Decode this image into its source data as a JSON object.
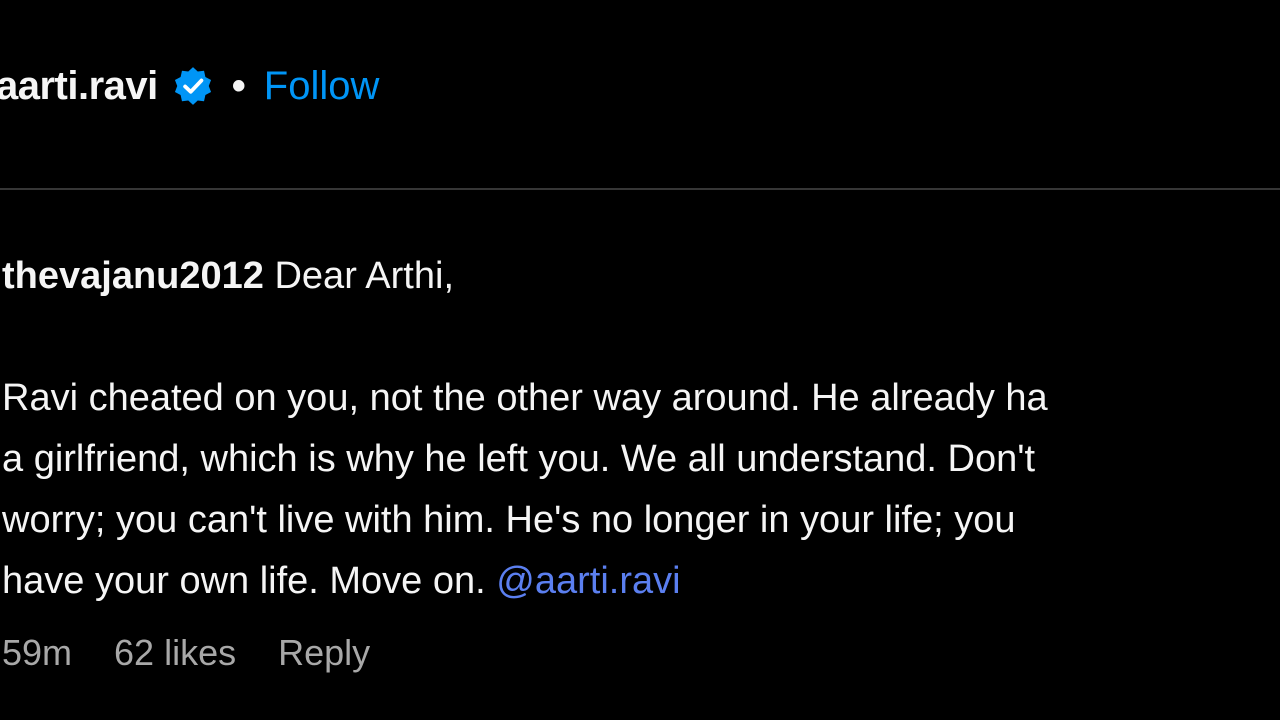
{
  "post_header": {
    "username": "aarti.ravi",
    "verified_icon": "verified-badge-icon",
    "separator": "•",
    "follow_label": "Follow"
  },
  "comment": {
    "author": "thevajanu2012",
    "greeting": "Dear Arthi,",
    "lines": [
      "Ravi cheated on you, not the other way around. He already ha",
      "a girlfriend, which is why he left you. We all understand. Don't",
      "worry; you can't live with him. He's no longer in your life; you",
      "have your own life. Move on."
    ],
    "mention": "@aarti.ravi",
    "time": "59m",
    "likes": "62 likes",
    "reply_label": "Reply"
  },
  "colors": {
    "background": "#000000",
    "text": "#f5f5f5",
    "follow": "#0095f6",
    "mention": "#5b7ff0",
    "meta": "#a8a8a8",
    "divider": "#363636"
  }
}
